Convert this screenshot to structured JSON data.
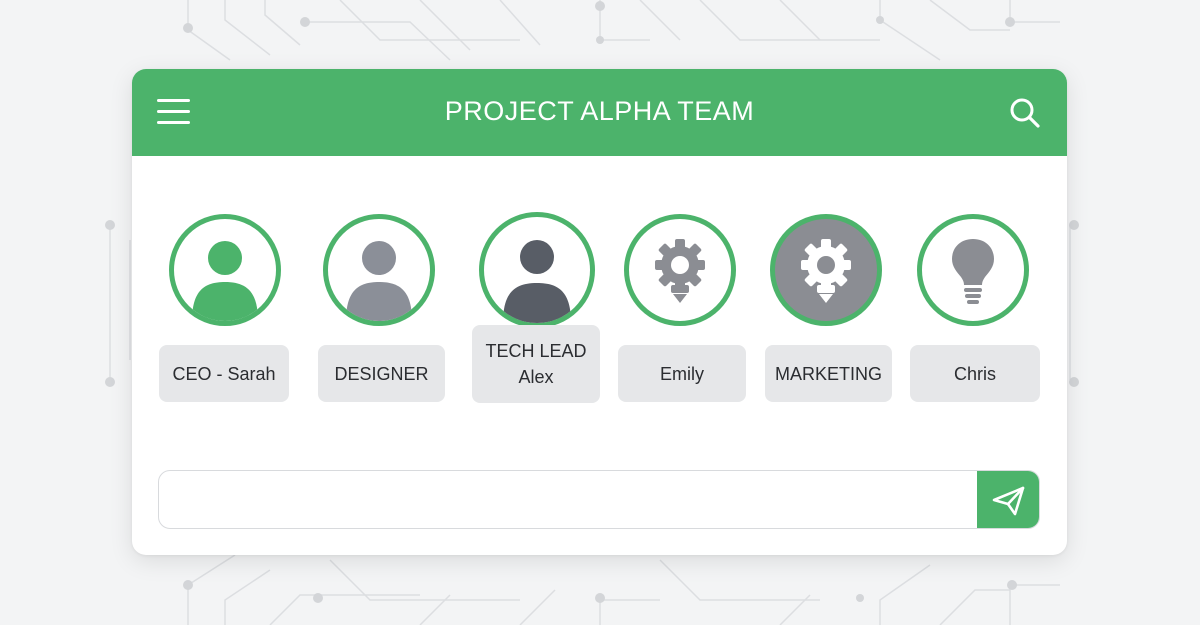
{
  "header": {
    "title": "PROJECT ALPHA TEAM",
    "menu_icon": "hamburger-menu-icon",
    "search_icon": "search-icon"
  },
  "members": [
    {
      "label": "CEO - Sarah",
      "icon": "person-icon",
      "icon_color": "#4cb36b",
      "avatar_bg": "#ffffff"
    },
    {
      "label": "DESIGNER",
      "icon": "person-icon",
      "icon_color": "#8b8f98",
      "avatar_bg": "#ffffff"
    },
    {
      "label_line1": "TECH LEAD",
      "label_line2": "Alex",
      "icon": "person-icon",
      "icon_color": "#585d66",
      "avatar_bg": "#ffffff"
    },
    {
      "label": "Emily",
      "icon": "gear-bulb-icon",
      "icon_color": "#8b8d93",
      "avatar_bg": "#ffffff"
    },
    {
      "label": "MARKETING",
      "icon": "gear-bulb-icon",
      "icon_color": "#ffffff",
      "avatar_bg": "#8b8d93"
    },
    {
      "label": "Chris",
      "icon": "lightbulb-icon",
      "icon_color": "#8b8d93",
      "avatar_bg": "#ffffff"
    }
  ],
  "message": {
    "value": "",
    "placeholder": "",
    "send_icon": "send-paper-plane-icon"
  },
  "colors": {
    "accent": "#4cb36b",
    "chip_bg": "#e6e7e9",
    "background": "#f3f4f5"
  }
}
